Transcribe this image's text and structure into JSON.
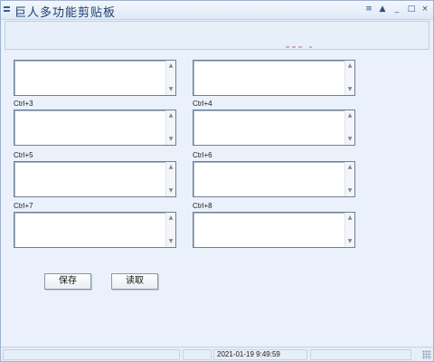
{
  "window": {
    "title": "巨人多功能剪贴板",
    "controls": {
      "menu": "≡",
      "up": "▲",
      "minimize": "_",
      "maximize": "□",
      "close": "×"
    }
  },
  "slots": [
    {
      "label": ""
    },
    {
      "label": ""
    },
    {
      "label": "Ctrl+3"
    },
    {
      "label": "Ctrl+4"
    },
    {
      "label": "Ctrl+5"
    },
    {
      "label": "Ctrl+6"
    },
    {
      "label": "Ctrl+7"
    },
    {
      "label": "Ctrl+8"
    }
  ],
  "buttons": {
    "save": "保存",
    "load": "读取"
  },
  "statusbar": {
    "datetime": "2021-01-19 9:49:59"
  },
  "icons": {
    "scroll_up": "▲",
    "scroll_down": "▼"
  }
}
